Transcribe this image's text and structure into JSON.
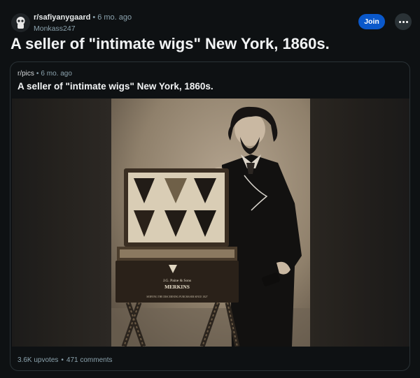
{
  "post": {
    "subreddit": "r/safiyanygaard",
    "age": "6 mo. ago",
    "author": "Monkass247",
    "join_label": "Join",
    "title": "A seller of \"intimate wigs\" New York, 1860s."
  },
  "crosspost": {
    "subreddit": "r/pics",
    "age": "6 mo. ago",
    "title": "A seller of \"intimate wigs\" New York, 1860s.",
    "photo": {
      "case_lines": [
        "J.G. Paine & Sons",
        "MERKINS",
        "SERVING THE DISCERNING PURCHASER SINCE 1827"
      ]
    },
    "upvotes": "3.6K upvotes",
    "comments": "471 comments"
  },
  "colors": {
    "background": "#0e1113",
    "accent": "#0a58ca",
    "muted": "#8ba2ad"
  },
  "icons": {
    "more": "ellipsis-icon",
    "avatar": "subreddit-avatar-icon"
  }
}
